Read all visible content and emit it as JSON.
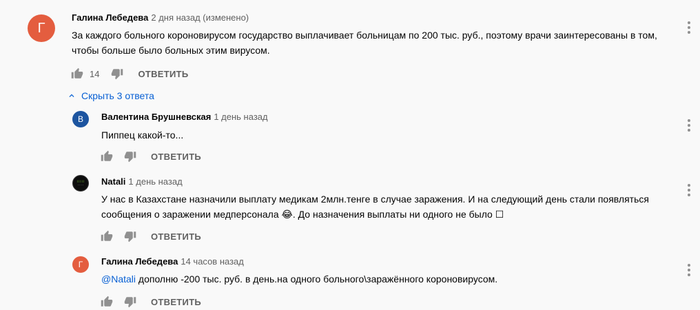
{
  "colors": {
    "accent_blue": "#065fd4",
    "secondary_text": "#606060",
    "icon": "#909090"
  },
  "comment_main": {
    "avatar_letter": "Г",
    "avatar_color": "#e45d3f",
    "author": "Галина Лебедева",
    "time": "2 дня назад (изменено)",
    "text": "За каждого больного короновирусом государство выплачивает больницам по 200 тыс. руб., поэтому врачи заинтересованы в том, чтобы больше было больных этим вирусом.",
    "likes": "14",
    "reply_label": "ОТВЕТИТЬ"
  },
  "replies_toggle": {
    "label": "Скрыть 3 ответа"
  },
  "replies": [
    {
      "avatar_letter": "В",
      "avatar_color": "#1d55a0",
      "author": "Валентина Брушневская",
      "time": "1 день назад",
      "text": "Пиппец какой-то...",
      "reply_label": "ОТВЕТИТЬ"
    },
    {
      "avatar_letter": "",
      "avatar_color": "#111111",
      "author": "Natali",
      "time": "1 день назад",
      "text": "У нас в Казахстане назначили выплату медикам 2млн.тенге в случае заражения. И на следующий день стали появляться сообщения о заражении медперсонала 😂. До назначения выплаты ни одного не было ☐",
      "reply_label": "ОТВЕТИТЬ"
    },
    {
      "avatar_letter": "Г",
      "avatar_color": "#e45d3f",
      "author": "Галина Лебедева",
      "time": "14 часов назад",
      "mention": "@Natali",
      "text": " дополню -200 тыс. руб. в день.на одного больного\\заражённого короновирусом.",
      "reply_label": "ОТВЕТИТЬ"
    }
  ]
}
